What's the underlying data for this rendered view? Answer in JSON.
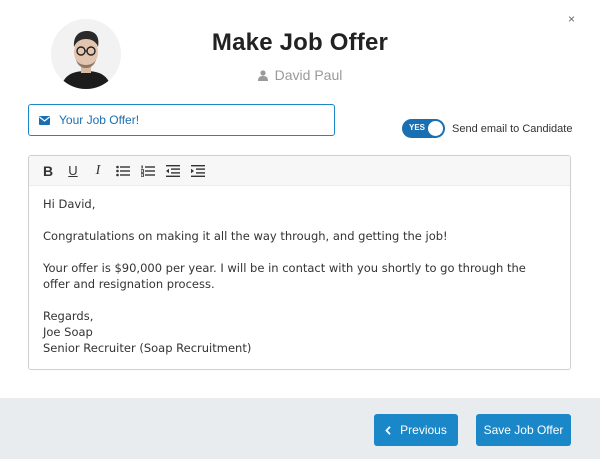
{
  "modal": {
    "title": "Make Job Offer",
    "close_label": "×"
  },
  "candidate": {
    "name": "David Paul",
    "icon": "user-icon"
  },
  "subject": {
    "value": "Your Job Offer!",
    "icon": "envelope-icon"
  },
  "email_toggle": {
    "state_label": "YES",
    "label": "Send email to Candidate",
    "checked": true,
    "color": "#1a6fb3"
  },
  "toolbar": {
    "bold_label": "B",
    "underline_label": "U",
    "italic_label": "I",
    "icons": [
      "bold-icon",
      "underline-icon",
      "italic-icon",
      "bulleted-list-icon",
      "numbered-list-icon",
      "outdent-icon",
      "indent-icon"
    ]
  },
  "letter": {
    "greeting": "Hi David,",
    "paragraph1": "Congratulations on making it all the way through, and getting the job!",
    "paragraph2": "Your offer is $90,000 per year. I will be in contact with you shortly to go through the offer and resignation process.",
    "closing": "Regards,",
    "signature_name": "Joe Soap",
    "signature_title": "Senior Recruiter (Soap Recruitment)"
  },
  "footer": {
    "previous_label": "Previous",
    "save_label": "Save Job Offer"
  },
  "colors": {
    "primary": "#1a87c9",
    "footer_bg": "#e9ecef"
  }
}
